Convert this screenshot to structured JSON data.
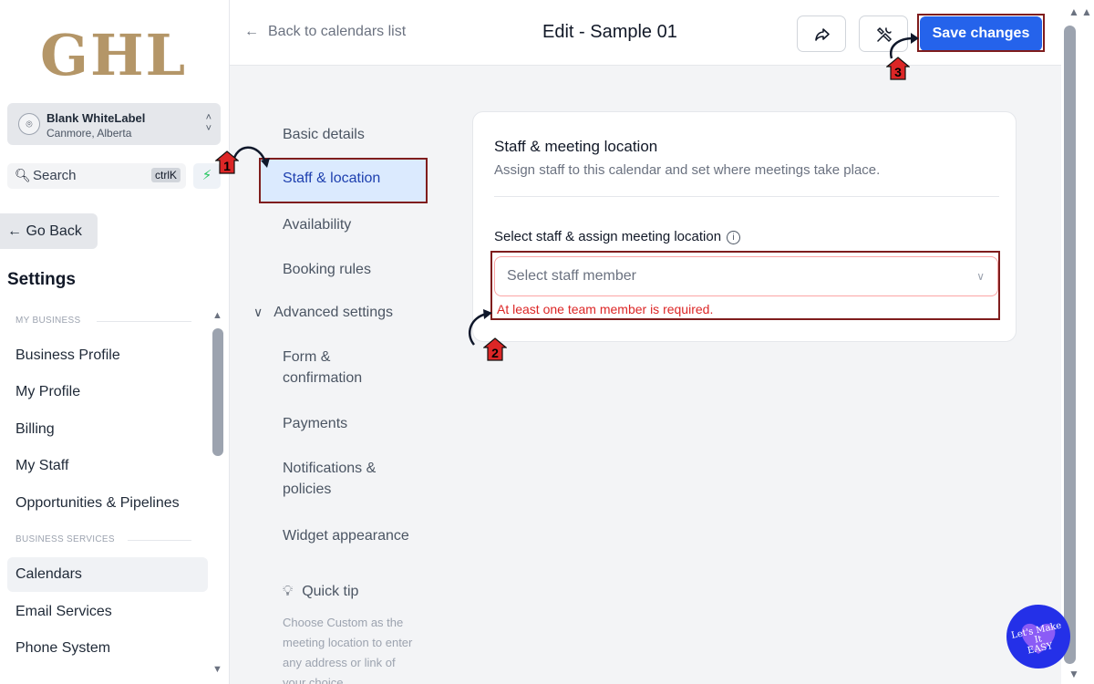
{
  "sidebar": {
    "logo": "GHL",
    "account": {
      "name": "Blank WhiteLabel",
      "location": "Canmore, Alberta"
    },
    "search": {
      "label": "Search",
      "shortcut": "ctrlK"
    },
    "go_back": "Go Back",
    "settings_title": "Settings",
    "sections": [
      {
        "label": "MY BUSINESS"
      },
      {
        "label": "BUSINESS SERVICES"
      }
    ],
    "items": [
      {
        "label": "Business Profile"
      },
      {
        "label": "My Profile"
      },
      {
        "label": "Billing"
      },
      {
        "label": "My Staff"
      },
      {
        "label": "Opportunities & Pipelines"
      },
      {
        "label": "Calendars",
        "active": true
      },
      {
        "label": "Email Services"
      },
      {
        "label": "Phone System"
      }
    ]
  },
  "header": {
    "back_label": "Back to calendars list",
    "title": "Edit - Sample 01",
    "save_label": "Save changes"
  },
  "subnav": {
    "items": [
      {
        "label": "Basic details"
      },
      {
        "label": "Staff & location",
        "active": true
      },
      {
        "label": "Availability"
      },
      {
        "label": "Booking rules"
      },
      {
        "label": "Advanced settings"
      },
      {
        "label_line1": "Form &",
        "label_line2": "confirmation"
      },
      {
        "label": "Payments"
      },
      {
        "label_line1": "Notifications &",
        "label_line2": "policies"
      },
      {
        "label": "Widget appearance"
      }
    ],
    "quick_tip": {
      "title": "Quick tip",
      "line1": "Choose Custom as the",
      "line2": "meeting location to enter",
      "line3": "any address or link of",
      "line4": "your choice"
    }
  },
  "card": {
    "title": "Staff & meeting location",
    "subtitle": "Assign staff to this calendar and set where meetings take place.",
    "field_label": "Select staff & assign meeting location",
    "placeholder": "Select staff member",
    "error": "At least one team member is required."
  },
  "annotations": {
    "step1": "1",
    "step2": "2",
    "step3": "3"
  },
  "watermark": {
    "line1": "Let's Make",
    "line2": "It",
    "line3": "EASY"
  },
  "colors": {
    "primary": "#2563eb",
    "error": "#dc2626",
    "annotation": "#7f1d1d",
    "badge": "#dc2626"
  }
}
